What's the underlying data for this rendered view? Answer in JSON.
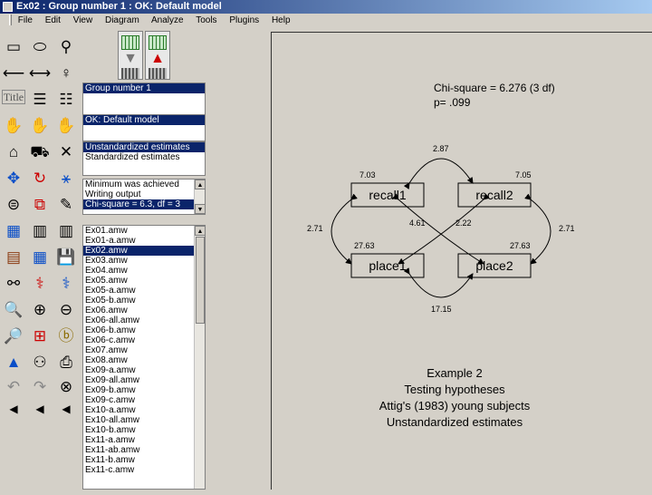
{
  "window": {
    "title": "Ex02 : Group number 1 : OK: Default model"
  },
  "menu": [
    "File",
    "Edit",
    "View",
    "Diagram",
    "Analyze",
    "Tools",
    "Plugins",
    "Help"
  ],
  "toolbox": {
    "tools": [
      "rectangle-icon",
      "ellipse-icon",
      "indicator-icon",
      "path-arrow-icon",
      "covariance-icon",
      "unique-var-icon",
      "title-icon",
      "list-variables-icon",
      "list-data-icon",
      "select-one-icon",
      "select-all-icon",
      "deselect-all-icon",
      "duplicate-icon",
      "move-icon",
      "erase-icon",
      "shape-change-icon",
      "rotate-icon",
      "reflect-icon",
      "move-params-icon",
      "reposition-icon",
      "touch-up-icon",
      "data-file-icon",
      "analysis-props-icon",
      "calculate-icon",
      "view-text-icon",
      "save-icon",
      "copy-clipboard-icon",
      "specification-search-icon",
      "multiple-group-icon",
      "print-icon",
      "zoom-select-icon",
      "zoom-in-icon",
      "zoom-out-icon",
      "zoom-page-icon",
      "fit-page-icon",
      "bayes-icon",
      "bayesian-icon",
      "degrees-freedom-icon",
      "loupe-icon",
      "undo-icon",
      "redo-icon",
      "binoculars-icon",
      "scroll-left-icon",
      "scroll-right-icon",
      "scroll-up-icon"
    ],
    "title_tool_label": "Title"
  },
  "groups": {
    "items": [
      "Group number 1"
    ]
  },
  "models": {
    "items": [
      "OK: Default model"
    ]
  },
  "estimates": {
    "items": [
      "Unstandardized estimates",
      "Standardized estimates"
    ]
  },
  "messages": {
    "items": [
      "Minimum was achieved",
      "Writing output",
      "Chi-square = 6.3, df = 3"
    ]
  },
  "files": {
    "items": [
      "Ex01.amw",
      "Ex01-a.amw",
      "Ex02.amw",
      "Ex03.amw",
      "Ex04.amw",
      "Ex05.amw",
      "Ex05-a.amw",
      "Ex05-b.amw",
      "Ex06.amw",
      "Ex06-all.amw",
      "Ex06-b.amw",
      "Ex06-c.amw",
      "Ex07.amw",
      "Ex08.amw",
      "Ex09-a.amw",
      "Ex09-all.amw",
      "Ex09-b.amw",
      "Ex09-c.amw",
      "Ex10-a.amw",
      "Ex10-all.amw",
      "Ex10-b.amw",
      "Ex11-a.amw",
      "Ex11-ab.amw",
      "Ex11-b.amw",
      "Ex11-c.amw"
    ]
  },
  "diagram": {
    "fit_line1": "Chi-square = 6.276 (3 df)",
    "fit_line2": "p= .099",
    "boxes": [
      "recall1",
      "recall2",
      "place1",
      "place2"
    ],
    "variances": [
      "7.03",
      "7.05",
      "27.63",
      "27.63"
    ],
    "cov_recall": "2.87",
    "cov_place": "17.15",
    "cov_left": "2.71",
    "cov_right": "2.71",
    "cov_diag1": "4.61",
    "cov_diag2": "2.22",
    "caption": [
      "Example 2",
      "Testing hypotheses",
      "Attig's (1983) young subjects",
      "Unstandardized estimates"
    ]
  }
}
